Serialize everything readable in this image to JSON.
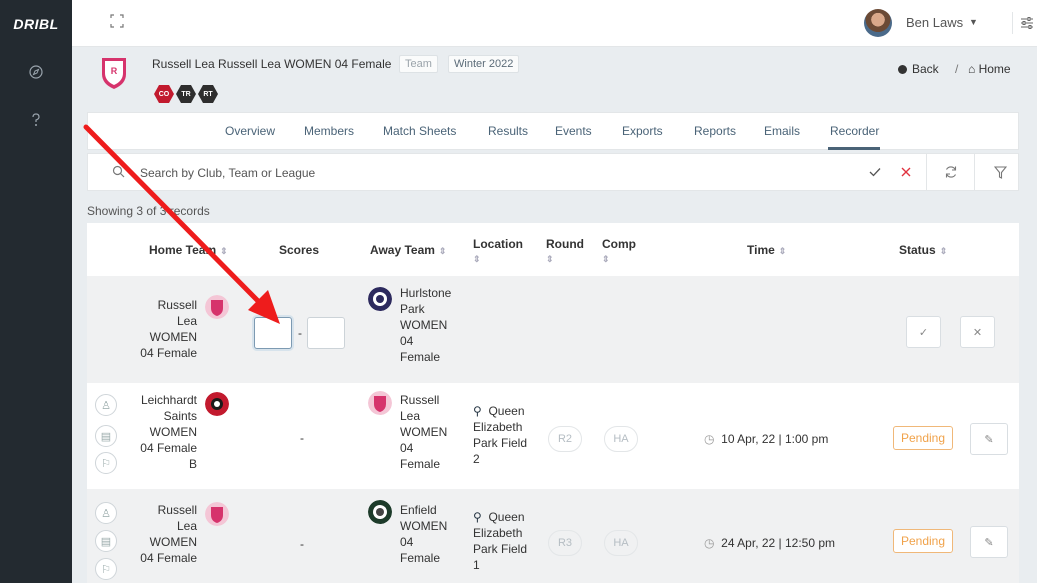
{
  "app": {
    "logo": "DRIBL"
  },
  "colors": {
    "sidebar": "#232a30",
    "accent": "#4a6377",
    "pending": "#f0a24a",
    "danger": "#c21a2e",
    "annotation_arrow": "#ee1c1c"
  },
  "user": {
    "name": "Ben Laws"
  },
  "team": {
    "title": "Russell Lea Russell Lea WOMEN 04 Female",
    "type_tag": "Team",
    "season_tag": "Winter 2022",
    "badges": [
      "CO",
      "TR",
      "RT"
    ]
  },
  "nav": {
    "back": "Back",
    "separator": "/",
    "home": "Home"
  },
  "tabs": [
    "Overview",
    "Members",
    "Match Sheets",
    "Results",
    "Events",
    "Exports",
    "Reports",
    "Emails",
    "Recorder"
  ],
  "active_tab": "Recorder",
  "search": {
    "placeholder": "Search by Club, Team or League"
  },
  "showing": "Showing 3 of 3 records",
  "columns": {
    "home_team": "Home Team",
    "scores": "Scores",
    "away_team": "Away Team",
    "location": "Location",
    "round": "Round",
    "comp": "Comp",
    "time": "Time",
    "status": "Status"
  },
  "edit_row": {
    "home": [
      "Russell",
      "Lea",
      "WOMEN",
      "04 Female"
    ],
    "score_separator": "-",
    "away": [
      "Hurlstone",
      "Park",
      "WOMEN",
      "04",
      "Female"
    ]
  },
  "rows": [
    {
      "home": [
        "Leichhardt",
        "Saints",
        "WOMEN",
        "04 Female",
        "B"
      ],
      "score": "-",
      "away": [
        "Russell",
        "Lea",
        "WOMEN",
        "04",
        "Female"
      ],
      "location": [
        "Queen",
        "Elizabeth",
        "Park Field",
        "2"
      ],
      "round": "R2",
      "comp": "HA",
      "time": "10 Apr, 22 | 1:00 pm",
      "status": "Pending"
    },
    {
      "home": [
        "Russell",
        "Lea",
        "WOMEN",
        "04 Female"
      ],
      "score": "-",
      "away": [
        "Enfield",
        "WOMEN",
        "04",
        "Female"
      ],
      "location": [
        "Queen",
        "Elizabeth",
        "Park Field",
        "1"
      ],
      "round": "R3",
      "comp": "HA",
      "time": "24 Apr, 22 | 12:50 pm",
      "status": "Pending"
    }
  ]
}
